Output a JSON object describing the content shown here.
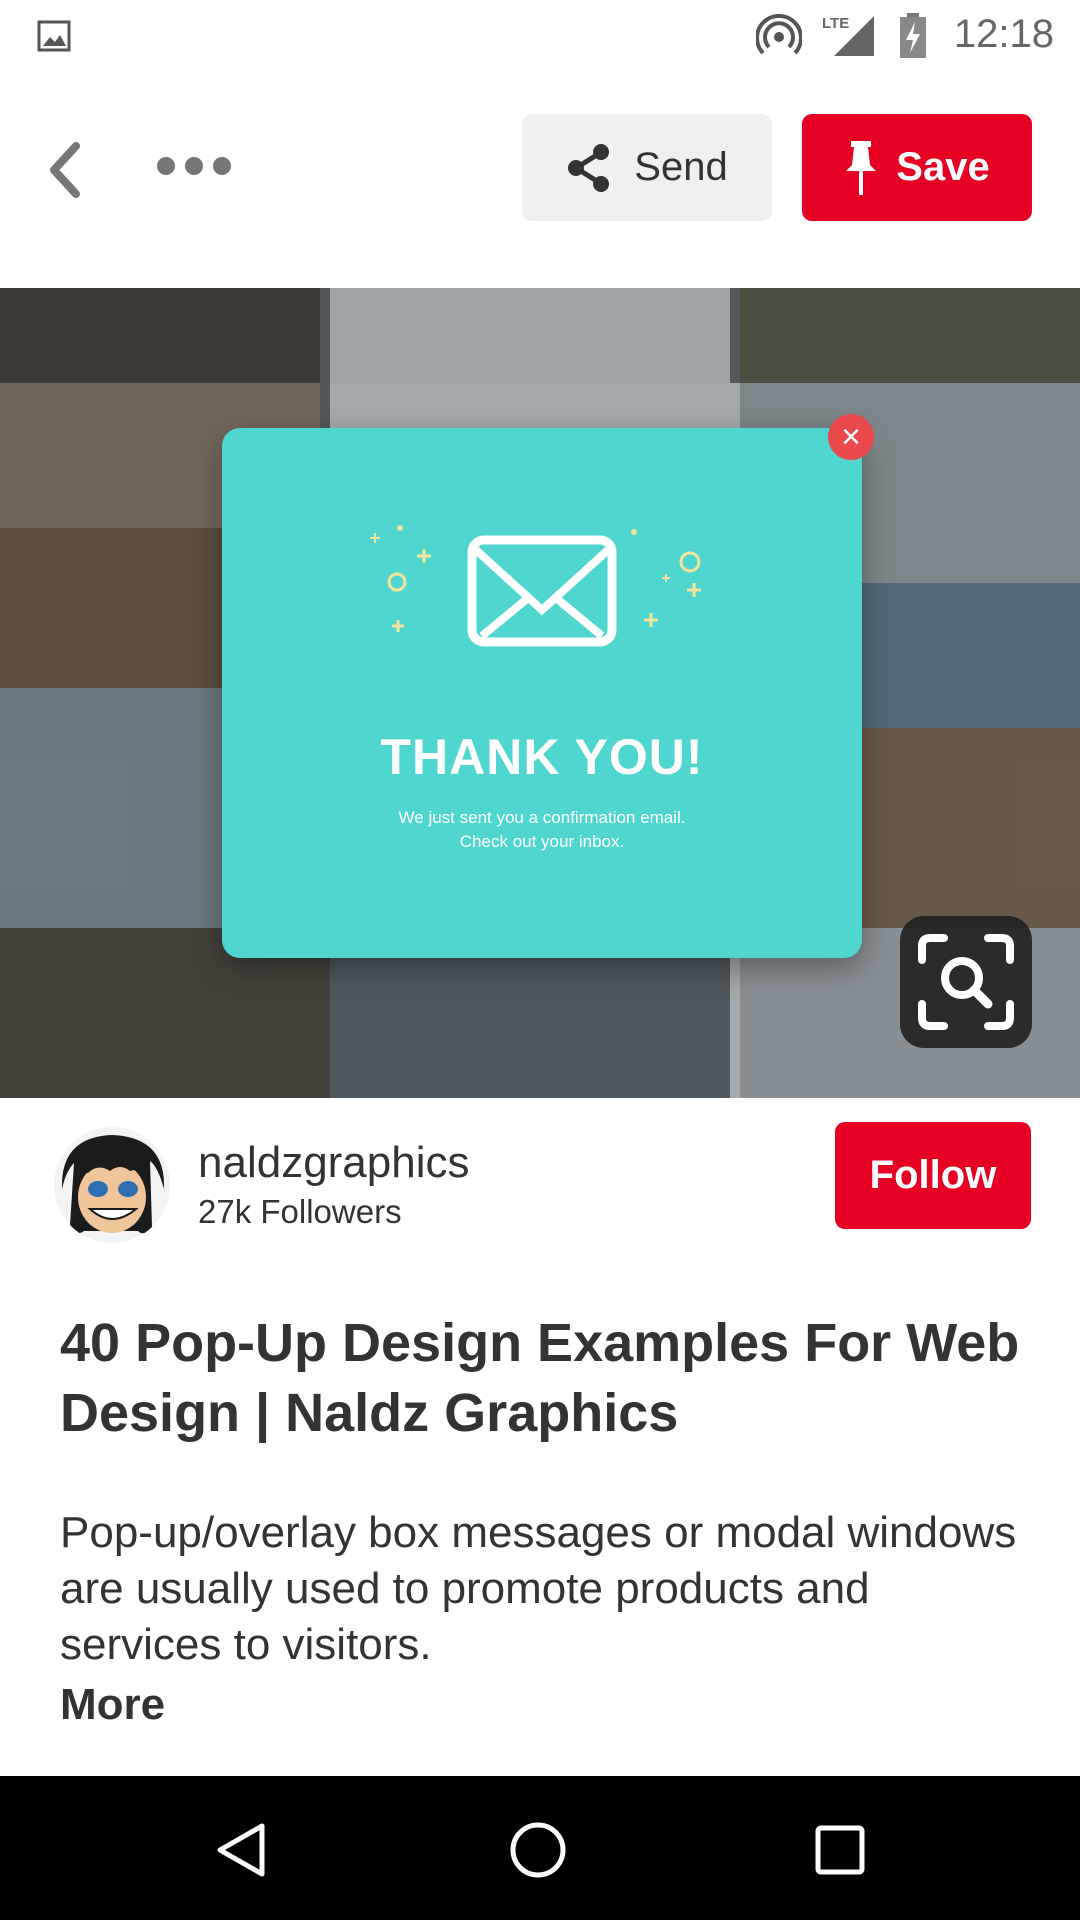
{
  "status_bar": {
    "time": "12:18",
    "network": "LTE",
    "icons": [
      "gallery-icon",
      "hotspot-icon",
      "lte-signal-icon",
      "battery-charging-icon"
    ]
  },
  "toolbar": {
    "send_label": "Send",
    "save_label": "Save",
    "icons": [
      "back-arrow-icon",
      "more-dots-icon",
      "share-icon",
      "pin-icon"
    ]
  },
  "pin_image": {
    "popup_title": "THANK YOU!",
    "popup_message_line1": "We just sent you a confirmation email.",
    "popup_message_line2": "Check out your inbox.",
    "popup_color": "#4fd6d0",
    "icons": [
      "envelope-icon",
      "close-icon",
      "visual-search-icon"
    ]
  },
  "creator": {
    "name": "naldzgraphics",
    "followers": "27k Followers",
    "follow_label": "Follow"
  },
  "pin": {
    "title": "40 Pop-Up Design Examples For Web Design | Naldz Graphics",
    "description": "Pop-up/overlay box messages or modal windows are usually used to promote products and services to visitors.",
    "more_label": "More"
  },
  "nav_bar": {
    "icons": [
      "nav-back-icon",
      "nav-home-icon",
      "nav-recents-icon"
    ]
  },
  "colors": {
    "brand_red": "#e60023",
    "send_bg": "#efefef"
  }
}
